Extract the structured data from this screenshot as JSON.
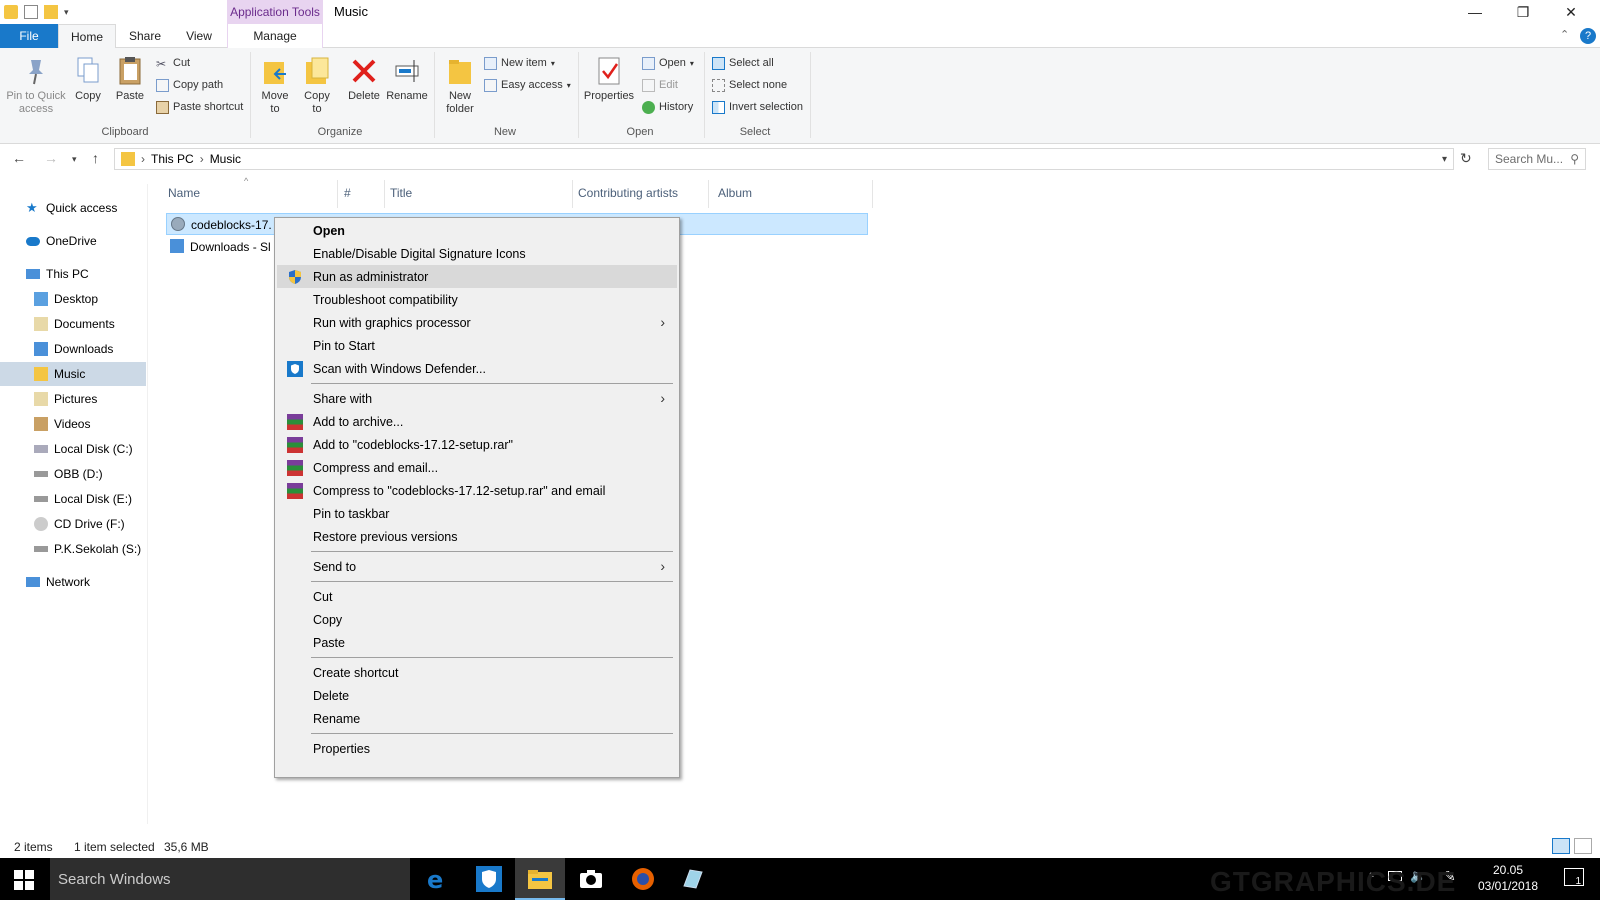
{
  "titlebar": {
    "app_tools": "Application Tools",
    "title": "Music",
    "minimize": "—",
    "maximize": "❐",
    "close": "✕"
  },
  "tabs": {
    "file": "File",
    "home": "Home",
    "share": "Share",
    "view": "View",
    "manage": "Manage"
  },
  "ribbon": {
    "pin": "Pin to Quick access",
    "copy": "Copy",
    "paste": "Paste",
    "cut": "Cut",
    "copy_path": "Copy path",
    "paste_shortcut": "Paste shortcut",
    "clipboard": "Clipboard",
    "move_to": "Move to",
    "copy_to": "Copy to",
    "delete": "Delete",
    "rename": "Rename",
    "organize": "Organize",
    "new_folder": "New folder",
    "new_item": "New item",
    "easy_access": "Easy access",
    "new": "New",
    "properties": "Properties",
    "open": "Open",
    "edit": "Edit",
    "history": "History",
    "open_group": "Open",
    "select_all": "Select all",
    "select_none": "Select none",
    "invert_selection": "Invert selection",
    "select": "Select"
  },
  "address": {
    "this_pc": "This PC",
    "music": "Music",
    "search_placeholder": "Search Mu..."
  },
  "nav": {
    "quick_access": "Quick access",
    "onedrive": "OneDrive",
    "this_pc": "This PC",
    "desktop": "Desktop",
    "documents": "Documents",
    "downloads": "Downloads",
    "music": "Music",
    "pictures": "Pictures",
    "videos": "Videos",
    "local_c": "Local Disk (C:)",
    "obb_d": "OBB (D:)",
    "local_e": "Local Disk (E:)",
    "cd_f": "CD Drive (F:)",
    "pk_s": "P.K.Sekolah (S:)",
    "network": "Network"
  },
  "columns": {
    "name": "Name",
    "num": "#",
    "title": "Title",
    "artists": "Contributing artists",
    "album": "Album"
  },
  "files": [
    "codeblocks-17.",
    "Downloads - Sl"
  ],
  "menu": {
    "open": "Open",
    "digital_sig": "Enable/Disable Digital Signature Icons",
    "run_admin": "Run as administrator",
    "troubleshoot": "Troubleshoot compatibility",
    "run_gpu": "Run with graphics processor",
    "pin_start": "Pin to Start",
    "scan_defender": "Scan with Windows Defender...",
    "share_with": "Share with",
    "add_archive": "Add to archive...",
    "add_rar": "Add to \"codeblocks-17.12-setup.rar\"",
    "compress_email": "Compress and email...",
    "compress_rar_email": "Compress to \"codeblocks-17.12-setup.rar\" and email",
    "pin_taskbar": "Pin to taskbar",
    "restore_versions": "Restore previous versions",
    "send_to": "Send to",
    "cut": "Cut",
    "copy": "Copy",
    "paste": "Paste",
    "create_shortcut": "Create shortcut",
    "delete": "Delete",
    "rename": "Rename",
    "properties": "Properties"
  },
  "status": {
    "items": "2 items",
    "selected": "1 item selected",
    "size": "35,6 MB"
  },
  "taskbar": {
    "search": "Search Windows",
    "time": "20.05",
    "date": "03/01/2018",
    "watermark": "GTGRAPHICS.DE",
    "notif_count": "1"
  }
}
